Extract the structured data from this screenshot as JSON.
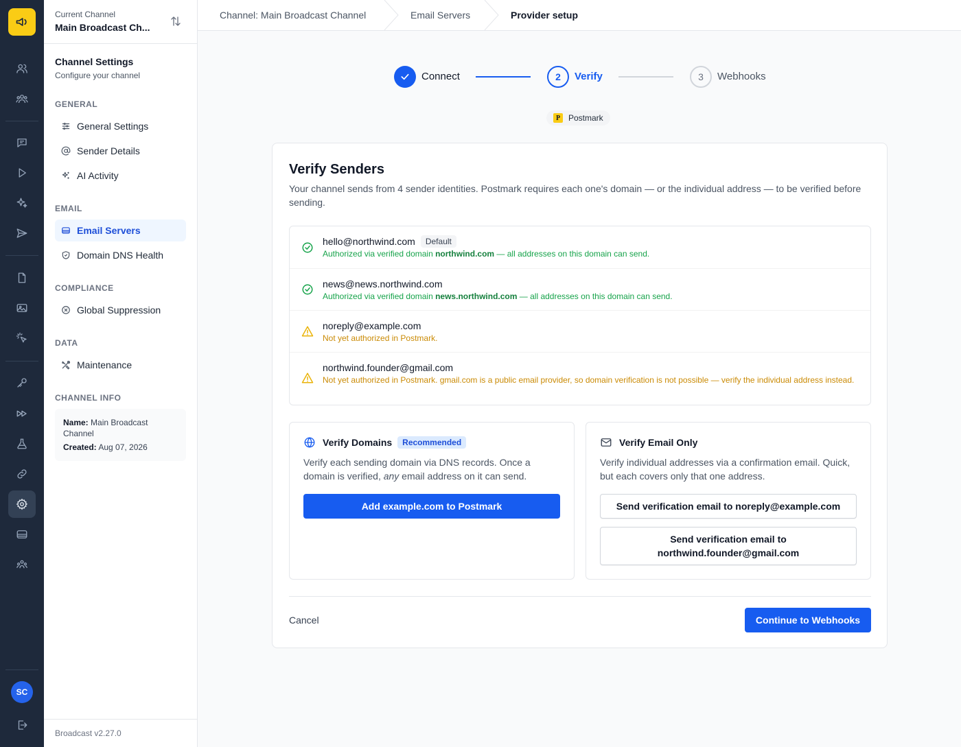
{
  "rail": {
    "icons": [
      "megaphone-icon",
      "users-icon",
      "user-group-icon",
      "chat-icon",
      "play-icon",
      "sparkles-icon",
      "send-icon",
      "document-icon",
      "image-icon",
      "cursor-click-icon",
      "key-icon",
      "forward-icon",
      "beaker-icon",
      "link-icon",
      "gear-icon",
      "server-icon",
      "team-icon",
      "logout-icon"
    ],
    "active": "gear-icon",
    "avatar_initials": "SC"
  },
  "channel": {
    "label": "Current Channel",
    "name": "Main Broadcast Ch..."
  },
  "sidebar": {
    "title": "Channel Settings",
    "subtitle": "Configure your channel",
    "sections": [
      {
        "label": "GENERAL",
        "items": [
          {
            "label": "General Settings",
            "icon": "sliders-icon"
          },
          {
            "label": "Sender Details",
            "icon": "at-sign-icon"
          },
          {
            "label": "AI Activity",
            "icon": "sparkles-icon"
          }
        ]
      },
      {
        "label": "EMAIL",
        "items": [
          {
            "label": "Email Servers",
            "icon": "server-icon",
            "active": true
          },
          {
            "label": "Domain DNS Health",
            "icon": "shield-icon"
          }
        ]
      },
      {
        "label": "COMPLIANCE",
        "items": [
          {
            "label": "Global Suppression",
            "icon": "x-circle-icon"
          }
        ]
      },
      {
        "label": "DATA",
        "items": [
          {
            "label": "Maintenance",
            "icon": "tools-icon"
          }
        ]
      },
      {
        "label": "CHANNEL INFO",
        "items": []
      }
    ],
    "info": {
      "name_label": "Name:",
      "name_value": "Main Broadcast Channel",
      "created_label": "Created:",
      "created_value": "Aug 07, 2026"
    },
    "version": "Broadcast v2.27.0"
  },
  "breadcrumb": [
    "Channel: Main Broadcast Channel",
    "Email Servers",
    "Provider setup"
  ],
  "stepper": [
    {
      "number": "1",
      "label": "Connect",
      "state": "complete"
    },
    {
      "number": "2",
      "label": "Verify",
      "state": "current"
    },
    {
      "number": "3",
      "label": "Webhooks",
      "state": "upcoming"
    }
  ],
  "provider": {
    "logo_letter": "P",
    "name": "Postmark"
  },
  "verify": {
    "title": "Verify Senders",
    "description": "Your channel sends from 4 sender identities. Postmark requires each one's domain — or the individual address — to be verified before sending.",
    "senders": [
      {
        "email": "hello@northwind.com",
        "badge": "Default",
        "status": "ok",
        "note_pre": "Authorized via verified domain ",
        "note_domain": "northwind.com",
        "note_post": " — all addresses on this domain can send."
      },
      {
        "email": "news@news.northwind.com",
        "badge": "",
        "status": "ok",
        "note_pre": "Authorized via verified domain ",
        "note_domain": "news.northwind.com",
        "note_post": " — all addresses on this domain can send."
      },
      {
        "email": "noreply@example.com",
        "badge": "",
        "status": "warn",
        "note": "Not yet authorized in Postmark."
      },
      {
        "email": "northwind.founder@gmail.com",
        "badge": "",
        "status": "warn",
        "note": "Not yet authorized in Postmark. gmail.com is a public email provider, so domain verification is not possible — verify the individual address instead."
      }
    ],
    "domains_option": {
      "title": "Verify Domains",
      "badge": "Recommended",
      "desc_1": "Verify each sending domain via DNS records. Once a domain is verified, ",
      "desc_em": "any",
      "desc_2": " email address on it can send.",
      "button": "Add example.com to Postmark"
    },
    "email_option": {
      "title": "Verify Email Only",
      "desc": "Verify individual addresses via a confirmation email. Quick, but each covers only that one address.",
      "buttons": [
        "Send verification email to noreply@example.com",
        "Send verification email to northwind.founder@gmail.com"
      ]
    },
    "cancel": "Cancel",
    "continue": "Continue to Webhooks"
  },
  "colors": {
    "accent": "#175cf0",
    "rail_bg": "#1e293b",
    "logo_bg": "#facc15",
    "success": "#16a34a",
    "warning": "#ca8a04"
  }
}
